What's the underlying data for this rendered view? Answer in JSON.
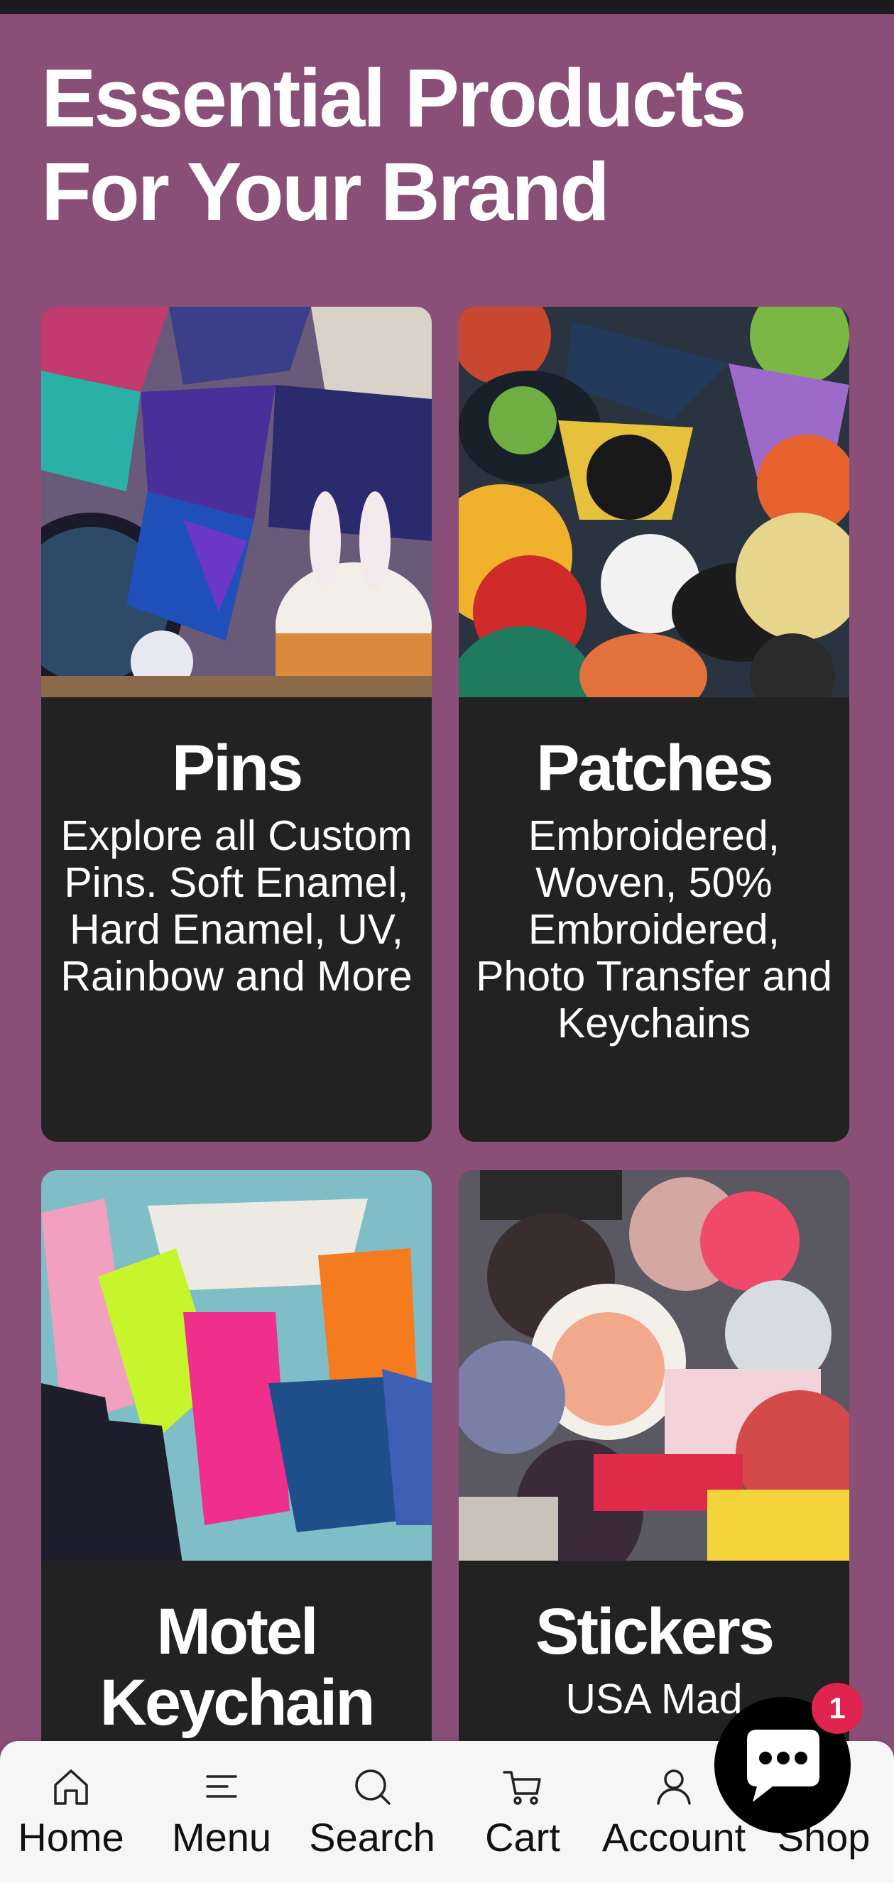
{
  "section": {
    "heading_line1": "Essential Products",
    "heading_line2": "For Your Brand"
  },
  "products": [
    {
      "title": "Pins",
      "description": "Explore all Custom Pins. Soft Enamel, Hard Enamel, UV, Rainbow and More"
    },
    {
      "title": "Patches",
      "description": "Embroidered, Woven, 50% Embroidered, Photo Transfer and Keychains"
    },
    {
      "title": "Motel Keychain",
      "description": ""
    },
    {
      "title": "Stickers",
      "description": "USA Mad"
    }
  ],
  "bottom_nav": {
    "items": [
      {
        "label": "Home",
        "icon": "home-icon"
      },
      {
        "label": "Menu",
        "icon": "menu-icon"
      },
      {
        "label": "Search",
        "icon": "search-icon"
      },
      {
        "label": "Cart",
        "icon": "cart-icon"
      },
      {
        "label": "Account",
        "icon": "account-icon"
      },
      {
        "label": "Shop",
        "icon": "shop-icon"
      }
    ]
  },
  "chat": {
    "icon": "chat-bubble-icon",
    "badge_count": "1"
  },
  "colors": {
    "background": "#8a4f76",
    "card": "#222222",
    "nav_background": "#f6f6f6",
    "badge": "#e0244f"
  }
}
